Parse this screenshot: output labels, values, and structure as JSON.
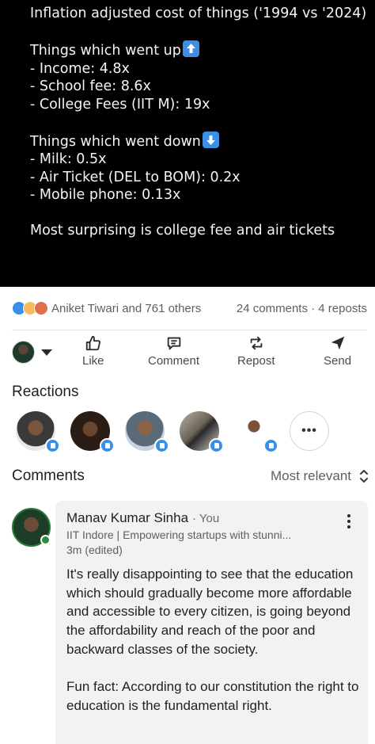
{
  "post": {
    "lines_a": [
      "Inflation adjusted cost of things ('1994 vs '2024)"
    ],
    "up_heading": "Things which went up",
    "up_items": [
      "- Income: 4.8x",
      "- School fee: 8.6x",
      "- College Fees (IIT M): 19x"
    ],
    "down_heading": "Things which went down",
    "down_items": [
      "- Milk: 0.5x",
      "- Air Ticket (DEL to BOM): 0.2x",
      "- Mobile phone: 0.13x"
    ],
    "closing": "Most surprising is college fee and air tickets",
    "up_icon": "arrow-up-emoji-icon",
    "down_icon": "arrow-down-emoji-icon"
  },
  "social": {
    "reactors": "Aniket Tiwari and 761 others",
    "stats": "24 comments · 4 reposts",
    "reaction_icons": [
      "like-reaction-icon",
      "insightful-reaction-icon",
      "love-reaction-icon"
    ]
  },
  "actions": [
    {
      "label": "Like",
      "icon": "thumbs-up-icon"
    },
    {
      "label": "Comment",
      "icon": "comment-icon"
    },
    {
      "label": "Repost",
      "icon": "repost-icon"
    },
    {
      "label": "Send",
      "icon": "send-icon"
    }
  ],
  "reactions_section": {
    "title": "Reactions",
    "more_label": "•••"
  },
  "comments_section": {
    "title": "Comments",
    "sort_label": "Most relevant"
  },
  "comment": {
    "author": "Manav Kumar Sinha",
    "you_tag": "· You",
    "headline": "IIT Indore | Empowering startups with stunni...",
    "time": "3m (edited)",
    "body": "It's really disappointing to see that the education which should gradually become more affordable and accessible to every citizen, is going beyond the affordability and reach of the poor and backward classes of the society.\n\nFun fact: According to our constitution the right to education is the fundamental right."
  },
  "colors": {
    "brand_blue": "#378fe9",
    "online_green": "#2e8a3f",
    "post_bg": "#000000"
  }
}
